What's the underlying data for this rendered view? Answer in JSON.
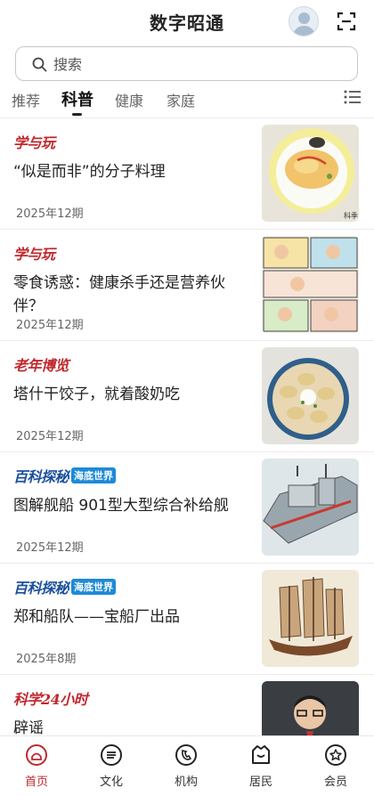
{
  "header": {
    "title": "数字昭通",
    "avatar": "user-avatar",
    "scan_icon": "scan-icon"
  },
  "search": {
    "placeholder": "搜索",
    "value": ""
  },
  "tabs": [
    {
      "label": "推荐",
      "active": false
    },
    {
      "label": "科普",
      "active": true
    },
    {
      "label": "健康",
      "active": false
    },
    {
      "label": "家庭",
      "active": false
    }
  ],
  "menu_icon": "list-menu-icon",
  "articles": [
    {
      "source": "学与玩",
      "source_color": "#c0282d",
      "title": "“似是而非”的分子料理",
      "date": "2025年12期",
      "thumb_caption": "科季"
    },
    {
      "source": "学与玩",
      "source_color": "#c0282d",
      "title": "零食诱惑：健康杀手还是营养伙伴？",
      "date": "2025年12期"
    },
    {
      "source": "老年博览",
      "source_color": "#c0282d",
      "title": "塔什干饺子，就着酸奶吃",
      "date": "2025年12期"
    },
    {
      "source": "百科探秘",
      "source_color": "#1b4f9c",
      "badge": "海底世界",
      "title": "图解舰船 901型大型综合补给舰",
      "date": "2025年12期"
    },
    {
      "source": "百科探秘",
      "source_color": "#1b4f9c",
      "badge": "海底世界",
      "title": "郑和船队——宝船厂出品",
      "date": "2025年8期"
    },
    {
      "source": "科学24小时",
      "source_color": "#c0282d",
      "title": "辟谣",
      "date": ""
    }
  ],
  "tabbar": [
    {
      "label": "首页",
      "icon": "home-icon",
      "active": true
    },
    {
      "label": "文化",
      "icon": "culture-icon",
      "active": false
    },
    {
      "label": "机构",
      "icon": "institution-icon",
      "active": false
    },
    {
      "label": "居民",
      "icon": "resident-icon",
      "active": false
    },
    {
      "label": "会员",
      "icon": "member-icon",
      "active": false
    }
  ],
  "colors": {
    "accent": "#c0282d",
    "badge": "#1e8ad6"
  }
}
